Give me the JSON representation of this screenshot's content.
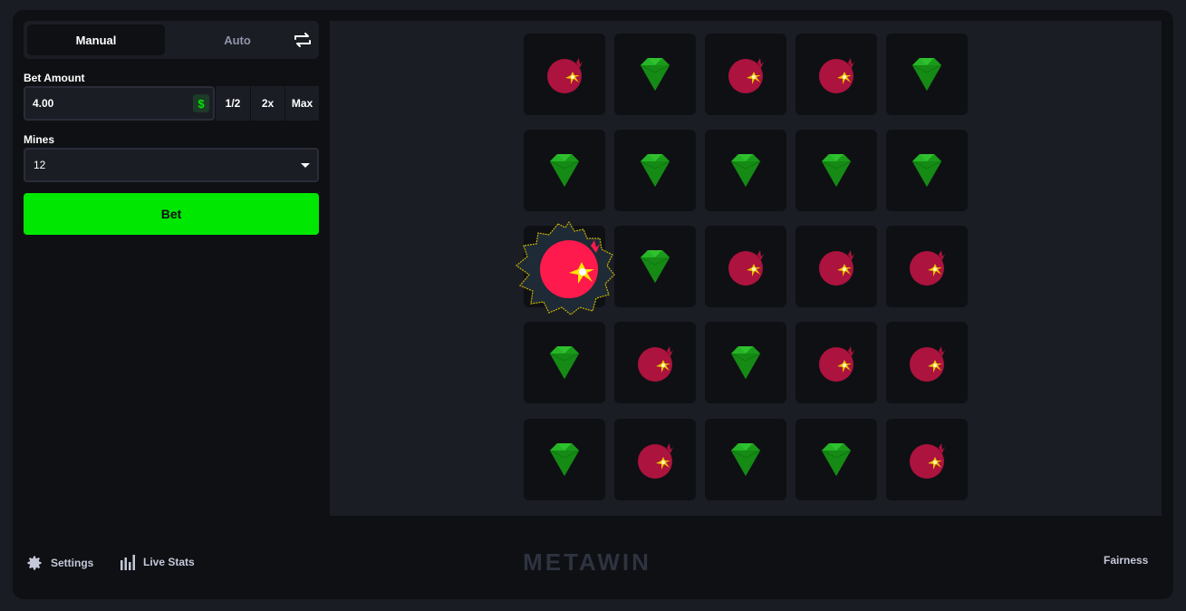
{
  "sidebar": {
    "tabs": [
      "Manual",
      "Auto"
    ],
    "active_tab": "Manual",
    "bet_amount_label": "Bet Amount",
    "bet_amount_value": "4.00",
    "currency_symbol": "$",
    "modifiers": [
      "1/2",
      "2x",
      "Max"
    ],
    "mines_label": "Mines",
    "mines_value": "12",
    "bet_button": "Bet"
  },
  "board": {
    "rows": [
      [
        "mine",
        "gem",
        "mine",
        "mine",
        "gem"
      ],
      [
        "gem",
        "gem",
        "gem",
        "gem",
        "gem"
      ],
      [
        "mine-hit",
        "gem",
        "mine",
        "mine",
        "mine"
      ],
      [
        "gem",
        "mine",
        "gem",
        "mine",
        "mine"
      ],
      [
        "gem",
        "mine",
        "gem",
        "gem",
        "mine"
      ]
    ]
  },
  "footer": {
    "settings": "Settings",
    "live_stats": "Live Stats",
    "brand": "METAWIN",
    "fairness": "Fairness"
  },
  "colors": {
    "accent_green": "#00e701",
    "gem": "#1ea81e",
    "mine": "#d8154a",
    "panel": "#1b1d25",
    "background": "#0f1014"
  },
  "icons": [
    "swap-icon",
    "dollar-icon",
    "chevron-down-icon",
    "gear-icon",
    "bar-chart-icon",
    "gem-icon",
    "mine-icon"
  ]
}
